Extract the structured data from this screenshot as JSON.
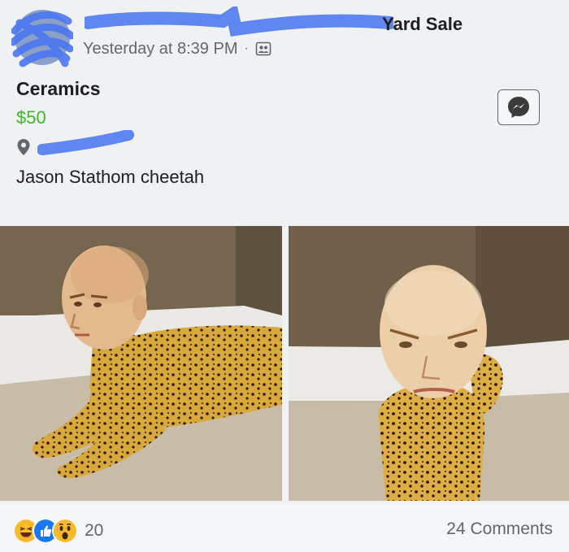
{
  "post": {
    "group_name_visible": "Yard Sale",
    "timestamp": "Yesterday at 8:39 PM",
    "separator": "·",
    "audience_icon": "group-audience-icon"
  },
  "listing": {
    "title": "Ceramics",
    "price": "$50",
    "description": "Jason Stathom cheetah",
    "location_icon": "location-pin-icon",
    "message_icon": "messenger-icon"
  },
  "footer": {
    "reaction_icons": [
      "haha-reaction-icon",
      "like-reaction-icon",
      "wow-reaction-icon"
    ],
    "reaction_count": "20",
    "comments": "24 Comments"
  },
  "colors": {
    "price": "#42b72a",
    "secondary_text": "#606770",
    "like_blue": "#1877f2",
    "reaction_yellow": "#f7b928",
    "redaction_blue": "#4a76f0"
  }
}
